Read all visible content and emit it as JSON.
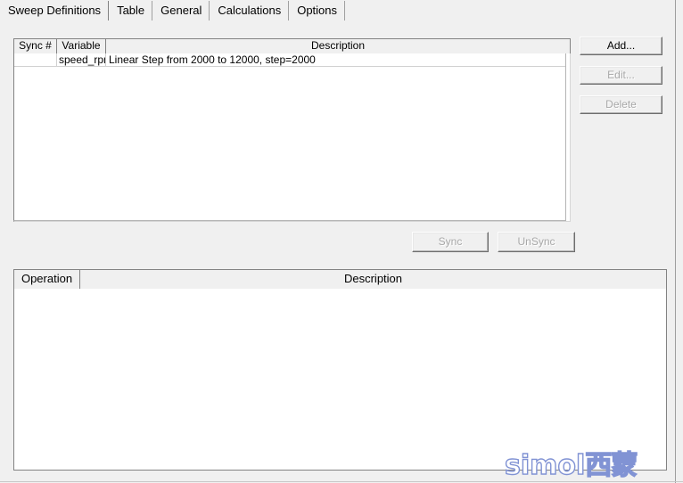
{
  "window": {
    "title": "Sweep Definitions"
  },
  "tabs": [
    {
      "label": "Sweep Definitions",
      "selected": true
    },
    {
      "label": "Table",
      "selected": false
    },
    {
      "label": "General",
      "selected": false
    },
    {
      "label": "Calculations",
      "selected": false
    },
    {
      "label": "Options",
      "selected": false
    }
  ],
  "sweep_table": {
    "columns": [
      "Sync #",
      "Variable",
      "Description"
    ],
    "rows": [
      {
        "sync": "",
        "variable": "speed_rpm",
        "description": "Linear Step from 2000 to 12000, step=2000"
      }
    ]
  },
  "side_buttons": {
    "add": {
      "label": "Add...",
      "enabled": true
    },
    "edit": {
      "label": "Edit...",
      "enabled": false
    },
    "delete": {
      "label": "Delete",
      "enabled": false
    }
  },
  "sync_buttons": {
    "sync": {
      "label": "Sync",
      "enabled": false
    },
    "unsync": {
      "label": "UnSync",
      "enabled": false
    }
  },
  "operations_table": {
    "columns": [
      "Operation",
      "Description"
    ],
    "rows": []
  },
  "watermark": {
    "latin": "simol",
    "cjk": "西蒙",
    "color": "#8193d4"
  }
}
